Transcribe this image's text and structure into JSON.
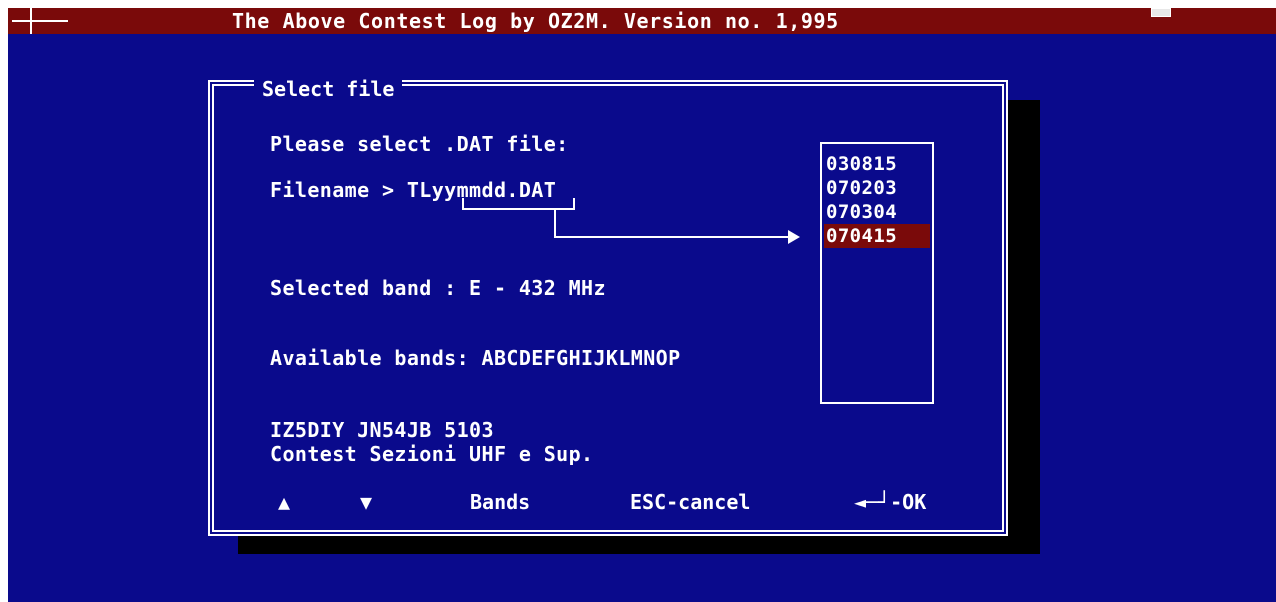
{
  "window": {
    "title": "The Above Contest Log by OZ2M. Version no. 1,995"
  },
  "dialog": {
    "title": "Select file",
    "prompt": "Please select .DAT file:",
    "filename_line": "Filename > TLyymmdd.DAT",
    "selected_band": "Selected band  : E - 432 MHz",
    "available_bands": "Available bands: ABCDEFGHIJKLMNOP",
    "station_line": "IZ5DIY JN54JB 5103",
    "contest_line": "Contest Sezioni UHF e Sup.",
    "files": [
      "030815",
      "070203",
      "070304",
      "070415"
    ],
    "selected_index": 3,
    "footer": {
      "up": "▲",
      "down": "▼",
      "bands": "Bands",
      "cancel": "ESC-cancel",
      "ok": "◄─┘-OK"
    }
  },
  "colors": {
    "screen": "#0a0a8c",
    "titlebar": "#7a0a0a",
    "highlight": "#7a0a0a",
    "text": "#ffffff",
    "shadow": "#000000"
  },
  "icons": {
    "system_menu": "system-menu-icon",
    "restore": "restore-icon"
  }
}
